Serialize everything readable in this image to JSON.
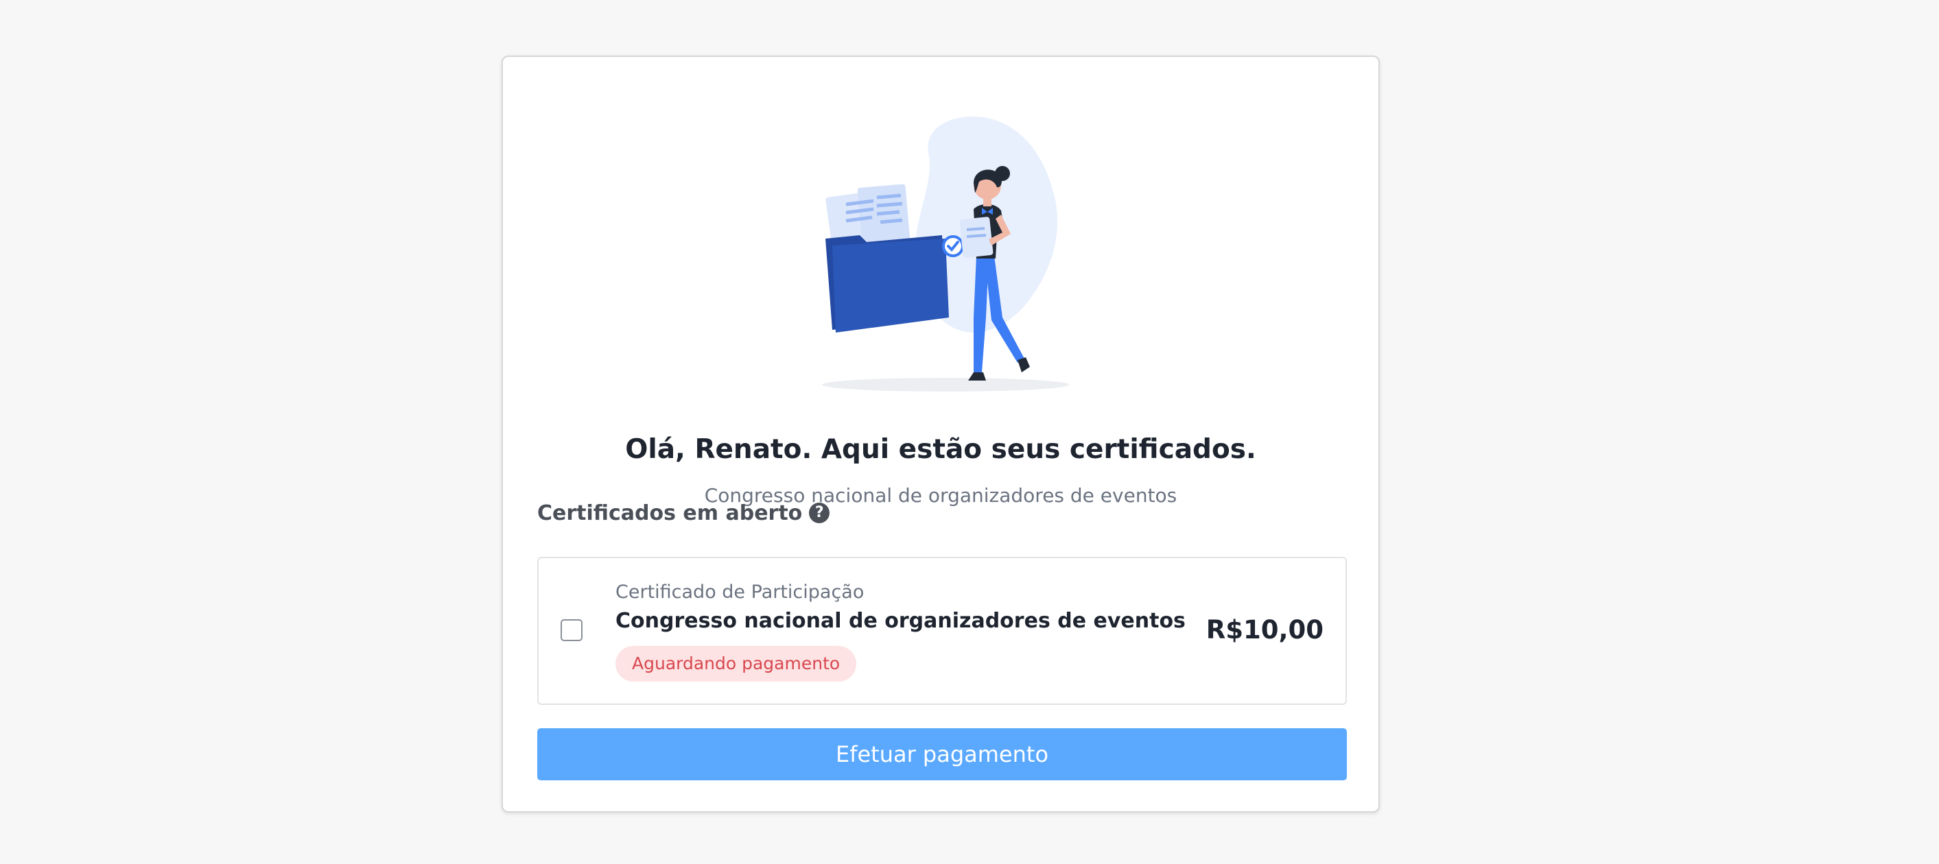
{
  "greeting": {
    "title": "Olá, Renato. Aqui estão seus certificados.",
    "subtitle": "Congresso nacional de organizadores de eventos"
  },
  "section": {
    "heading": "Certificados em aberto",
    "help_icon": "question-circle-icon"
  },
  "certificates": [
    {
      "type": "Certificado de Participação",
      "name": "Congresso nacional de organizadores de eventos",
      "status": "Aguardando pagamento",
      "price": "R$10,00",
      "checked": false
    }
  ],
  "actions": {
    "pay_label": "Efetuar pagamento"
  },
  "colors": {
    "primary": "#5aa9ff",
    "folder": "#2b57b8",
    "illustration_blue": "#3c7cf4",
    "status_bg": "#fde3e3",
    "status_text": "#d8474f",
    "blob": "#e8f0fd"
  }
}
